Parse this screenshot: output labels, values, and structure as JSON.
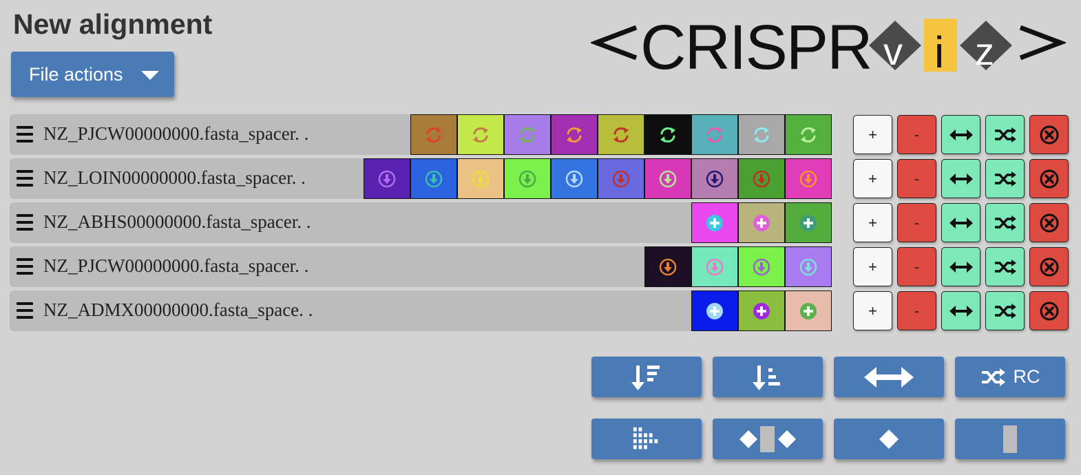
{
  "page_title": "New alignment",
  "file_actions": {
    "label": "File actions"
  },
  "logo": {
    "text": "<CRISPRviz>",
    "accent": "#f5c542",
    "diamond": "#4a4a4a"
  },
  "rows": [
    {
      "label": "NZ_PJCW00000000.fasta_spacer. .",
      "icon": "sync-icon",
      "spacers": [
        {
          "bg": "#a97b38",
          "fg": "#e0402e"
        },
        {
          "bg": "#c4e84a",
          "fg": "#c27c48"
        },
        {
          "bg": "#a77be8",
          "fg": "#72b85a"
        },
        {
          "bg": "#a12fb0",
          "fg": "#f09a3c"
        },
        {
          "bg": "#b8bd3c",
          "fg": "#c0342a"
        },
        {
          "bg": "#0e0e0e",
          "fg": "#6ef08a"
        },
        {
          "bg": "#55b0b8",
          "fg": "#e85ca8"
        },
        {
          "bg": "#a8a8a8",
          "fg": "#8ee8f0"
        },
        {
          "bg": "#54b03c",
          "fg": "#b8f0a0"
        }
      ]
    },
    {
      "label": "NZ_LOIN00000000.fasta_spacer. .",
      "icon": "arrow-down-circle-icon",
      "spacers": [
        {
          "bg": "#5a22b0",
          "fg": "#b070f0"
        },
        {
          "bg": "#2a62e0",
          "fg": "#3cc0a8"
        },
        {
          "bg": "#ecc284",
          "fg": "#e8e03a"
        },
        {
          "bg": "#7af04a",
          "fg": "#4ca84c"
        },
        {
          "bg": "#3474e0",
          "fg": "#b8d8f8"
        },
        {
          "bg": "#6a6ae0",
          "fg": "#c03030"
        },
        {
          "bg": "#d838b8",
          "fg": "#b0e890"
        },
        {
          "bg": "#b47cb0",
          "fg": "#281870"
        },
        {
          "bg": "#4aa032",
          "fg": "#c42e22"
        },
        {
          "bg": "#e03cb8",
          "fg": "#f0982e"
        }
      ]
    },
    {
      "label": "NZ_ABHS00000000.fasta_spacer. .",
      "icon": "plus-circle-icon",
      "spacers": [
        {
          "bg": "#e848f0",
          "fg": "#3cc8e0"
        },
        {
          "bg": "#b8b47c",
          "fg": "#e060d8"
        },
        {
          "bg": "#54ac3c",
          "fg": "#3e9c78"
        }
      ]
    },
    {
      "label": "NZ_PJCW00000000.fasta_spacer. .",
      "icon": "arrow-down-circle-icon",
      "spacers": [
        {
          "bg": "#1c0e24",
          "fg": "#e8802a"
        },
        {
          "bg": "#74e8b8",
          "fg": "#e87ac8"
        },
        {
          "bg": "#7af04a",
          "fg": "#a060d0"
        },
        {
          "bg": "#a87cf0",
          "fg": "#80e0d8"
        }
      ]
    },
    {
      "label": "NZ_ADMX00000000.fasta_space. .",
      "icon": "plus-circle-icon",
      "spacers": [
        {
          "bg": "#0a1ce8",
          "fg": "#a0d8f8"
        },
        {
          "bg": "#8cbc3c",
          "fg": "#a028e0"
        },
        {
          "bg": "#e8bcac",
          "fg": "#5cb04c"
        }
      ]
    }
  ],
  "row_controls": {
    "add_label": "+",
    "remove_label": "-"
  },
  "toolbar": {
    "reverse_complement_label": "RC"
  }
}
